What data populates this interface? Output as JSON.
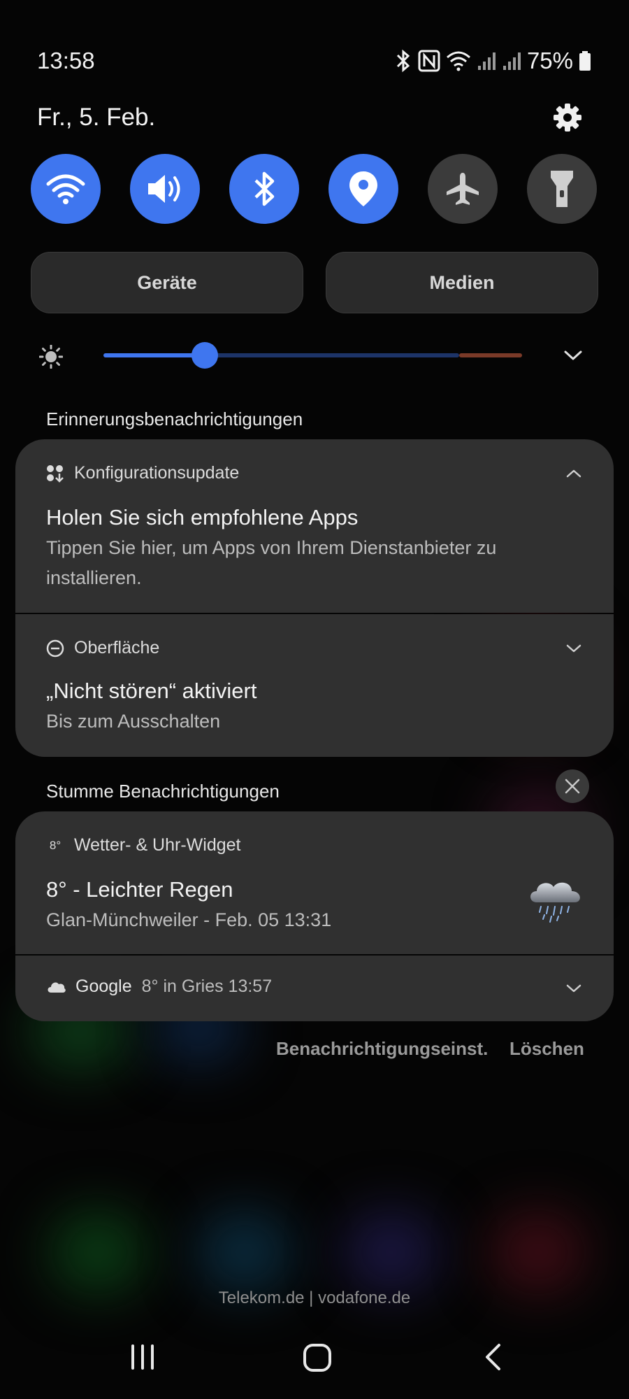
{
  "status": {
    "time": "13:58",
    "battery": "75%"
  },
  "date": "Fr., 5. Feb.",
  "toggles": [
    {
      "name": "wifi-icon",
      "state": "on"
    },
    {
      "name": "sound-icon",
      "state": "on"
    },
    {
      "name": "bluetooth-icon",
      "state": "on"
    },
    {
      "name": "location-icon",
      "state": "on"
    },
    {
      "name": "airplane-icon",
      "state": "off"
    },
    {
      "name": "flashlight-icon",
      "state": "off"
    }
  ],
  "buttons": {
    "devices": "Geräte",
    "media": "Medien"
  },
  "brightness": {
    "level": 0.24
  },
  "sections": {
    "reminder": "Erinnerungsbenachrichtigungen",
    "silent": "Stumme Benachrichtigungen"
  },
  "notifications": [
    {
      "app": "Konfigurationsupdate",
      "title": "Holen Sie sich empfohlene Apps",
      "body": "Tippen Sie hier, um Apps von Ihrem Dienstanbieter zu installieren."
    },
    {
      "app": "Oberfläche",
      "title": "„Nicht stören“ aktiviert",
      "body": "Bis zum Ausschalten"
    },
    {
      "app_icon_text": "8°",
      "app": "Wetter- & Uhr-Widget",
      "title": "8° -  Leichter Regen",
      "body": "Glan-Münchweiler - Feb. 05  13:31"
    },
    {
      "app": "Google",
      "summary": "8° in Gries  13:57"
    }
  ],
  "actions": {
    "settings": "Benachrichtigungseinst.",
    "clear": "Löschen"
  },
  "carrier": "Telekom.de | vodafone.de",
  "colors": {
    "accent": "#3f76ef",
    "card": "#303030",
    "background": "#050505"
  }
}
